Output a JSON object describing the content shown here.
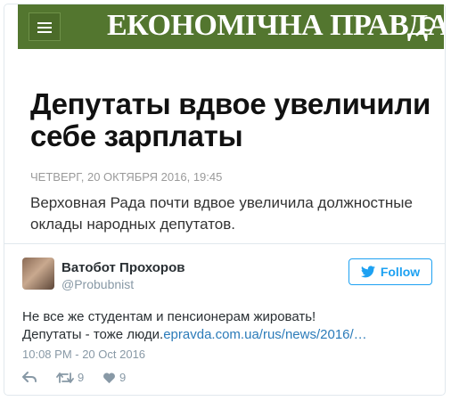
{
  "site": {
    "masthead": "ЕКОНОМІЧНА ПРАВДА"
  },
  "article": {
    "title": "Депутаты вдвое увеличили себе зарплаты",
    "date": "ЧЕТВЕРГ, 20 ОКТЯБРЯ 2016, 19:45",
    "lead": "Верховная Рада почти вдвое увеличила должностные оклады народных депутатов."
  },
  "tweet": {
    "author_name": "Ватобот Прохоров",
    "author_handle": "@Probubnist",
    "follow_label": "Follow",
    "text_line1": "Не все же студентам и пенсионерам жировать!",
    "text_line2_prefix": "Депутаты - тоже люди.",
    "link_text": "epravda.com.ua/rus/news/2016/…",
    "timestamp": "10:08 PM - 20 Oct 2016",
    "retweets": "9",
    "likes": "9"
  },
  "colors": {
    "header_bg": "#53762f",
    "twitter_blue": "#1da1f2",
    "muted": "#8899a6"
  },
  "icons": [
    "menu-icon",
    "search-icon",
    "twitter-bird-icon",
    "reply-icon",
    "retweet-icon",
    "heart-icon"
  ]
}
